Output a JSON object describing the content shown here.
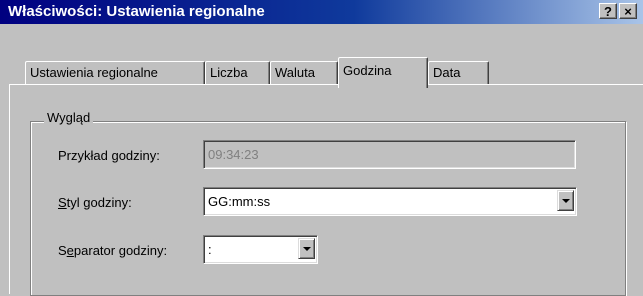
{
  "window": {
    "title": "Właściwości: Ustawienia regionalne",
    "help_label": "?",
    "close_label": "×"
  },
  "tabs": [
    {
      "label": "Ustawienia regionalne",
      "active": false
    },
    {
      "label": "Liczba",
      "active": false
    },
    {
      "label": "Waluta",
      "active": false
    },
    {
      "label": "Godzina",
      "active": true
    },
    {
      "label": "Data",
      "active": false
    }
  ],
  "group": {
    "legend": "Wygląd",
    "sample": {
      "label": "Przykład godziny:",
      "value": "09:34:23"
    },
    "style": {
      "label_key": "S",
      "label_rest": "tyl godziny:",
      "value": "GG:mm:ss"
    },
    "separator": {
      "label_pre": "S",
      "label_key": "e",
      "label_rest": "parator godziny:",
      "value": ":"
    }
  },
  "colors": {
    "titlebar_start": "#000080",
    "titlebar_end": "#a9c4e8",
    "face": "#c0c0c0"
  }
}
